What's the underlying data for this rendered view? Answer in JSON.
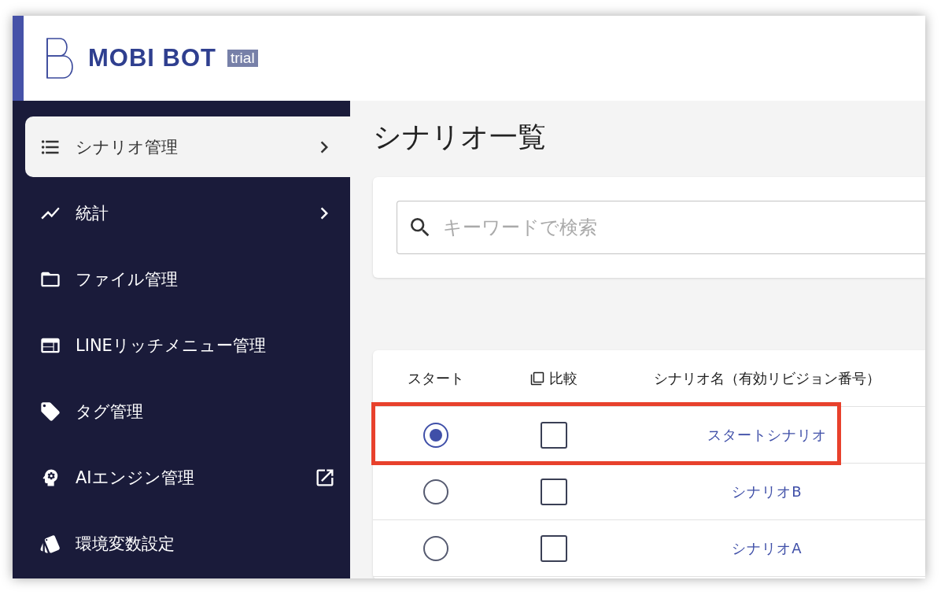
{
  "header": {
    "logo": "MOBI BOT",
    "badge": "trial"
  },
  "sidebar": {
    "items": [
      {
        "label": "シナリオ管理",
        "selected": true
      },
      {
        "label": "統計",
        "selected": false
      },
      {
        "label": "ファイル管理",
        "selected": false
      },
      {
        "label": "LINEリッチメニュー管理",
        "selected": false
      },
      {
        "label": "タグ管理",
        "selected": false
      },
      {
        "label": "AIエンジン管理",
        "selected": false
      },
      {
        "label": "環境変数設定",
        "selected": false
      }
    ]
  },
  "page_title": "シナリオ一覧",
  "search": {
    "placeholder": "キーワードで検索"
  },
  "table": {
    "columns": [
      {
        "label": "スタート",
        "kind": "text"
      },
      {
        "label": "比較",
        "kind": "compare"
      },
      {
        "label": "シナリオ名（有効リビジョン番号）",
        "kind": "text"
      }
    ],
    "rows": [
      {
        "start": {
          "selected": true
        },
        "compare": {
          "checked": false
        },
        "name": "スタートシナリオ",
        "highlighted": true
      },
      {
        "start": {
          "selected": false
        },
        "compare": {
          "checked": false
        },
        "name": "シナリオB",
        "highlighted": false
      },
      {
        "start": {
          "selected": false
        },
        "compare": {
          "checked": false
        },
        "name": "シナリオA",
        "highlighted": false
      }
    ]
  }
}
